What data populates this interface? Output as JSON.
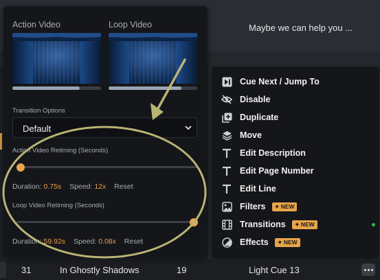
{
  "panel": {
    "action_video_label": "Action Video",
    "loop_video_label": "Loop Video",
    "transition_options_label": "Transition Options",
    "transition_value": "Default",
    "action_retiming_label": "Action Video Retiming (Seconds)",
    "action": {
      "duration_label": "Duration:",
      "duration": "0.75s",
      "speed_label": "Speed:",
      "speed": "12x",
      "reset": "Reset",
      "slider_level": 0.0,
      "progress": 0.76
    },
    "loop_retiming_label": "Loop Video Retiming (Seconds)",
    "loop": {
      "duration_label": "Duration:",
      "duration": "59.92s",
      "speed_label": "Speed:",
      "speed": "0.08x",
      "reset": "Reset",
      "slider_level": 1.0,
      "progress": 0.82
    }
  },
  "menu": {
    "items": [
      {
        "label": "Cue Next / Jump To",
        "icon": "skip-next-icon"
      },
      {
        "label": "Disable",
        "icon": "eye-off-icon"
      },
      {
        "label": "Duplicate",
        "icon": "duplicate-icon"
      },
      {
        "label": "Move",
        "icon": "layers-icon"
      },
      {
        "label": "Edit Description",
        "icon": "text-icon"
      },
      {
        "label": "Edit Page Number",
        "icon": "text-icon"
      },
      {
        "label": "Edit Line",
        "icon": "text-icon"
      },
      {
        "label": "Filters",
        "icon": "image-icon",
        "badge": "NEW"
      },
      {
        "label": "Transitions",
        "icon": "film-icon",
        "badge": "NEW"
      },
      {
        "label": "Effects",
        "icon": "effects-icon",
        "badge": "NEW"
      }
    ]
  },
  "background": {
    "help_text": "Maybe we can help you ...",
    "row": {
      "number": "31",
      "title": "In Ghostly Shadows",
      "page": "19",
      "cue": "Light Cue 13"
    }
  },
  "colors": {
    "accent": "#e8a54a",
    "annotation": "#b9b475",
    "status_green": "#2fb84a"
  }
}
